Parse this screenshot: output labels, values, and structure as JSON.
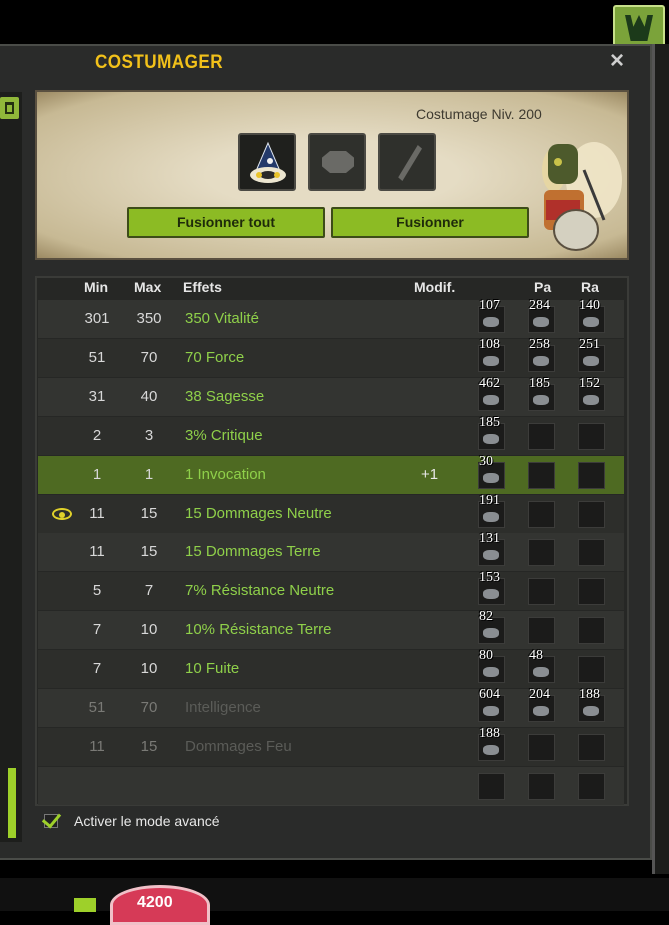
{
  "window": {
    "title": "COSTUMAGER",
    "close_label": "×"
  },
  "header": {
    "level_text": "Costumage Niv. 200",
    "fuse_all_label": "Fusionner tout",
    "fuse_label": "Fusionner"
  },
  "table": {
    "headers": {
      "min": "Min",
      "max": "Max",
      "effects": "Effets",
      "modif": "Modif.",
      "pa": "Pa",
      "ra": "Ra"
    },
    "rows": [
      {
        "min": "301",
        "max": "350",
        "effect": "350 Vitalité",
        "modif": "",
        "r1": "107",
        "r2": "284",
        "r3": "140",
        "dim": false,
        "highlight": false,
        "eye": false
      },
      {
        "min": "51",
        "max": "70",
        "effect": "70 Force",
        "modif": "",
        "r1": "108",
        "r2": "258",
        "r3": "251",
        "dim": false,
        "highlight": false,
        "eye": false
      },
      {
        "min": "31",
        "max": "40",
        "effect": "38 Sagesse",
        "modif": "",
        "r1": "462",
        "r2": "185",
        "r3": "152",
        "dim": false,
        "highlight": false,
        "eye": false
      },
      {
        "min": "2",
        "max": "3",
        "effect": "3% Critique",
        "modif": "",
        "r1": "185",
        "r2": "",
        "r3": "",
        "dim": false,
        "highlight": false,
        "eye": false
      },
      {
        "min": "1",
        "max": "1",
        "effect": "1 Invocation",
        "modif": "+1",
        "r1": "30",
        "r2": "",
        "r3": "",
        "dim": false,
        "highlight": true,
        "eye": false
      },
      {
        "min": "11",
        "max": "15",
        "effect": "15 Dommages Neutre",
        "modif": "",
        "r1": "191",
        "r2": "",
        "r3": "",
        "dim": false,
        "highlight": false,
        "eye": true
      },
      {
        "min": "11",
        "max": "15",
        "effect": "15 Dommages Terre",
        "modif": "",
        "r1": "131",
        "r2": "",
        "r3": "",
        "dim": false,
        "highlight": false,
        "eye": false
      },
      {
        "min": "5",
        "max": "7",
        "effect": "7% Résistance Neutre",
        "modif": "",
        "r1": "153",
        "r2": "",
        "r3": "",
        "dim": false,
        "highlight": false,
        "eye": false
      },
      {
        "min": "7",
        "max": "10",
        "effect": "10% Résistance Terre",
        "modif": "",
        "r1": "82",
        "r2": "",
        "r3": "",
        "dim": false,
        "highlight": false,
        "eye": false
      },
      {
        "min": "7",
        "max": "10",
        "effect": "10 Fuite",
        "modif": "",
        "r1": "80",
        "r2": "48",
        "r3": "",
        "dim": false,
        "highlight": false,
        "eye": false
      },
      {
        "min": "51",
        "max": "70",
        "effect": "Intelligence",
        "modif": "",
        "r1": "604",
        "r2": "204",
        "r3": "188",
        "dim": true,
        "highlight": false,
        "eye": false
      },
      {
        "min": "11",
        "max": "15",
        "effect": "Dommages Feu",
        "modif": "",
        "r1": "188",
        "r2": "",
        "r3": "",
        "dim": true,
        "highlight": false,
        "eye": false
      },
      {
        "min": "",
        "max": "",
        "effect": "",
        "modif": "",
        "r1": "",
        "r2": "",
        "r3": "",
        "dim": false,
        "highlight": false,
        "eye": false
      }
    ]
  },
  "footer": {
    "advanced_mode_label": "Activer le mode avancé",
    "advanced_mode_checked": true
  },
  "hud": {
    "life_value": "4200"
  },
  "colors": {
    "title": "#f2c11a",
    "accent_green": "#8cbb24",
    "effect_text": "#8fd04a"
  }
}
